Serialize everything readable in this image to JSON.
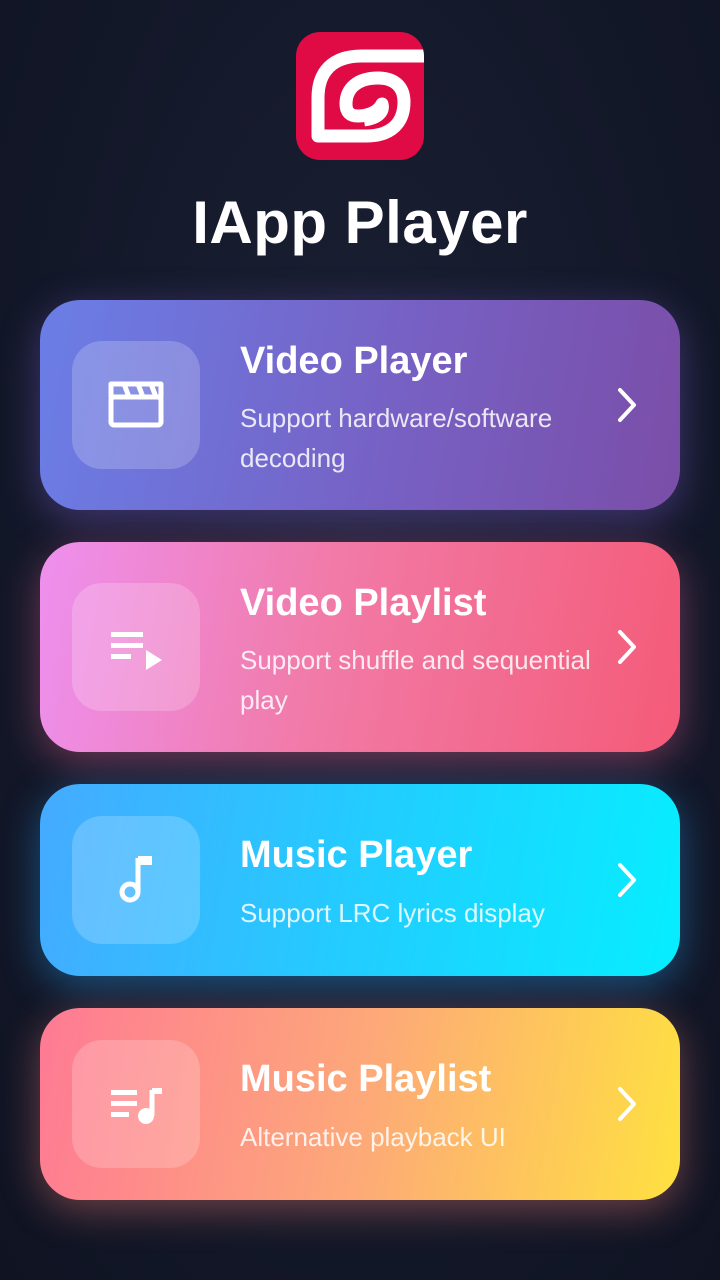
{
  "app": {
    "title": "IApp Player",
    "logo_icon": "spiral-logo-icon",
    "brand_color": "#e00a45"
  },
  "menu": {
    "items": [
      {
        "title": "Video Player",
        "description": "Support hardware/software decoding",
        "icon": "clapperboard-icon",
        "gradient": [
          "#6a7ee6",
          "#7a4ea8"
        ]
      },
      {
        "title": "Video Playlist",
        "description": "Support shuffle and sequential play",
        "icon": "playlist-play-icon",
        "gradient": [
          "#ee90ef",
          "#f45b78"
        ]
      },
      {
        "title": "Music Player",
        "description": "Support LRC lyrics display",
        "icon": "music-note-icon",
        "gradient": [
          "#45aaff",
          "#06eeff"
        ]
      },
      {
        "title": "Music Playlist",
        "description": "Alternative playback UI",
        "icon": "music-playlist-icon",
        "gradient": [
          "#fe7a94",
          "#fee140"
        ]
      }
    ],
    "chevron_icon": "chevron-right-icon"
  },
  "colors": {
    "background": "#151a2c"
  }
}
